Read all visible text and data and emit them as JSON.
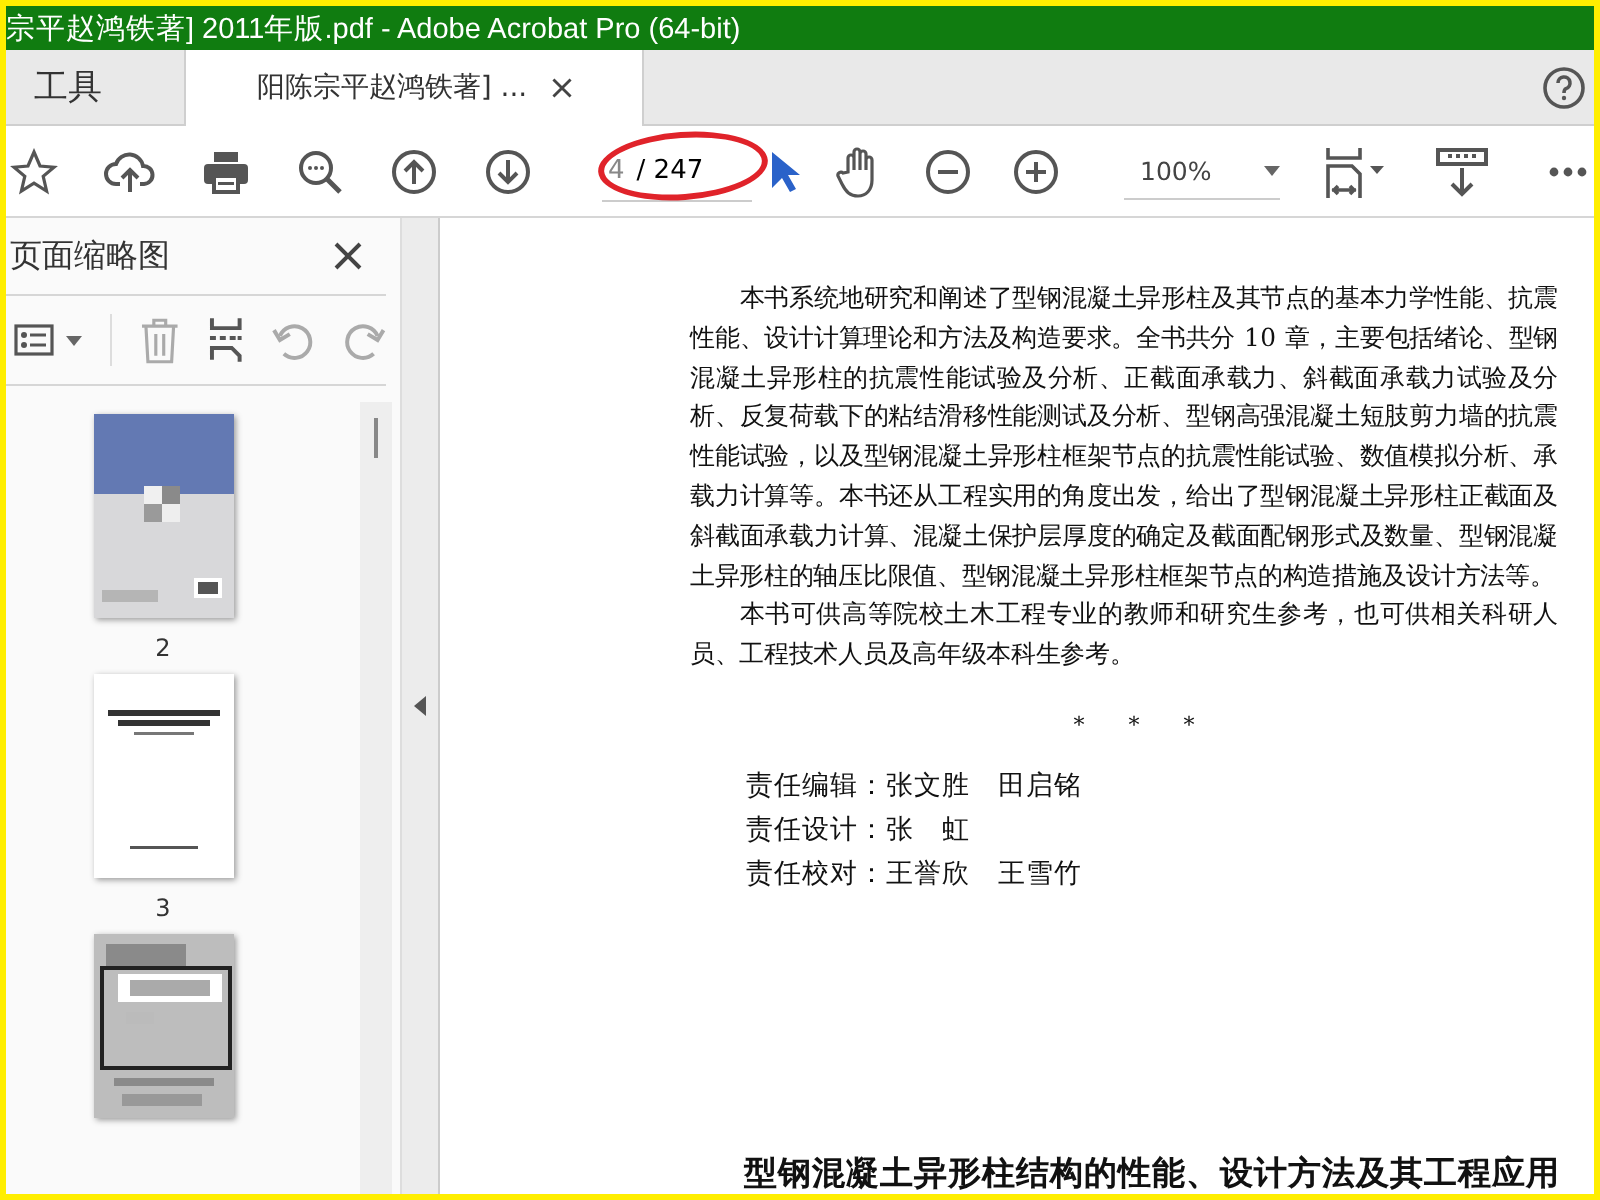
{
  "window": {
    "title": "宗平赵鸿铁著] 2011年版.pdf - Adobe Acrobat Pro (64-bit)"
  },
  "tabs": [
    {
      "label": "工具",
      "selected": false,
      "closable": false
    },
    {
      "label": "阳陈宗平赵鸿铁著] ...",
      "selected": true,
      "closable": true
    }
  ],
  "toolbar": {
    "page_field": {
      "value": "4",
      "total": "/ 247"
    },
    "zoom_field": {
      "value": "100%"
    }
  },
  "thumbnail_panel": {
    "title": "页面缩略图",
    "thumbnails": [
      {
        "label": "2",
        "kind": "cover",
        "selected": false
      },
      {
        "label": "3",
        "kind": "title",
        "selected": false
      },
      {
        "kind": "text",
        "selected": true
      }
    ]
  },
  "document": {
    "paragraphs": [
      "本书系统地研究和阐述了型钢混凝土异形柱及其节点的基本力学性能、抗震性能、设计计算理论和方法及构造要求。全书共分 10 章，主要包括绪论、型钢混凝土异形柱的抗震性能试验及分析、正截面承载力、斜截面承载力试验及分析、反复荷载下的粘结滑移性能测试及分析、型钢高强混凝土短肢剪力墙的抗震性能试验，以及型钢混凝土异形柱框架节点的抗震性能试验、数值模拟分析、承载力计算等。本书还从工程实用的角度出发，给出了型钢混凝土异形柱正截面及斜截面承载力计算、混凝土保护层厚度的确定及截面配钢形式及数量、型钢混凝土异形柱的轴压比限值、型钢混凝土异形柱框架节点的构造措施及设计方法等。",
      "本书可供高等院校土木工程专业的教师和研究生参考，也可供相关科研人员、工程技术人员及高年级本科生参考。"
    ],
    "separator": "*　　*　　*",
    "credits": [
      "责任编辑：张文胜　田启铭",
      "责任设计：张　虹",
      "责任校对：王誉欣　王雪竹"
    ],
    "book_title": "型钢混凝土异形柱结构的性能、设计方法及其工程应用"
  }
}
